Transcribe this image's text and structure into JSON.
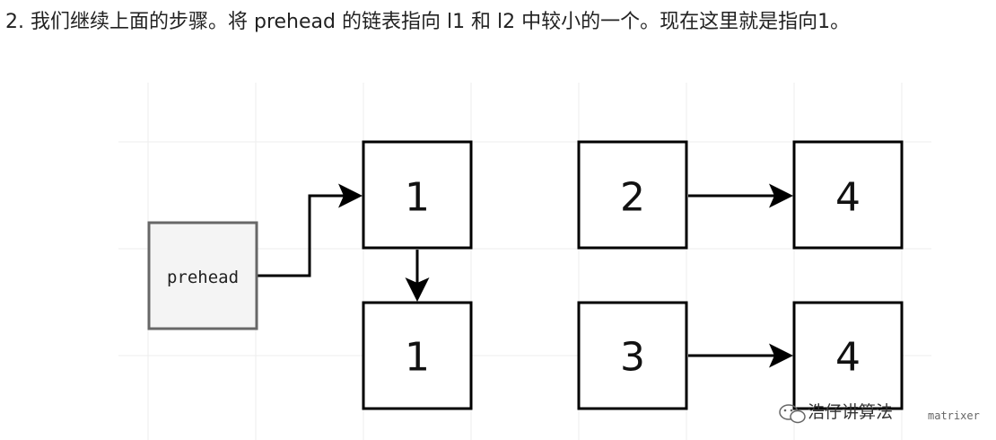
{
  "paragraph": {
    "text": "2. 我们继续上面的步骤。将 prehead 的链表指向 l1 和 l2 中较小的一个。现在这里就是指向1。"
  },
  "diagram": {
    "prehead": {
      "label": "prehead"
    },
    "list1": {
      "node1": "1",
      "node2": "1"
    },
    "list2_top": {
      "node1": "2",
      "node2": "4"
    },
    "list2_bottom": {
      "node1": "3",
      "node2": "4"
    }
  },
  "watermark": {
    "name": "浩仔讲算法",
    "handle": "matrixer"
  }
}
